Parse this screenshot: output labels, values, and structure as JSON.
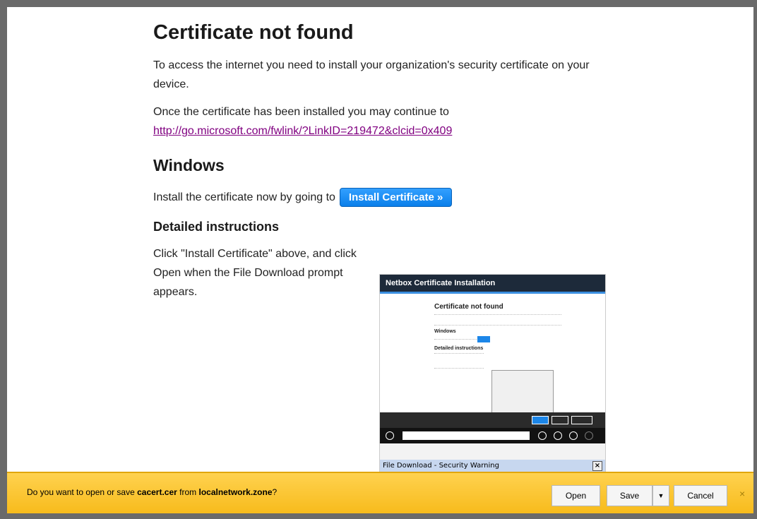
{
  "page": {
    "title": "Certificate not found",
    "intro": "To access the internet you need to install your organization's security certificate on your device.",
    "continue_text": "Once the certificate has been installed you may continue to",
    "continue_link": "http://go.microsoft.com/fwlink/?LinkID=219472&clcid=0x409",
    "windows_heading": "Windows",
    "install_prompt": "Install the certificate now by going to",
    "install_button": "Install Certificate »",
    "detailed_heading": "Detailed instructions",
    "detailed_text": "Click \"Install Certificate\" above, and click Open when the File Download prompt appears."
  },
  "screenshot": {
    "header": "Netbox Certificate Installation",
    "title": "Certificate not found",
    "windows": "Windows",
    "detailed": "Detailed instructions",
    "file_download_title": "File Download - Security Warning",
    "close_glyph": "×"
  },
  "download_bar": {
    "prefix": "Do you want to open or save ",
    "filename": "cacert.cer",
    "middle": " from ",
    "domain": "localnetwork.zone",
    "suffix": "?",
    "open_label": "Open",
    "save_label": "Save",
    "cancel_label": "Cancel",
    "dropdown_glyph": "▼",
    "close_glyph": "×"
  }
}
